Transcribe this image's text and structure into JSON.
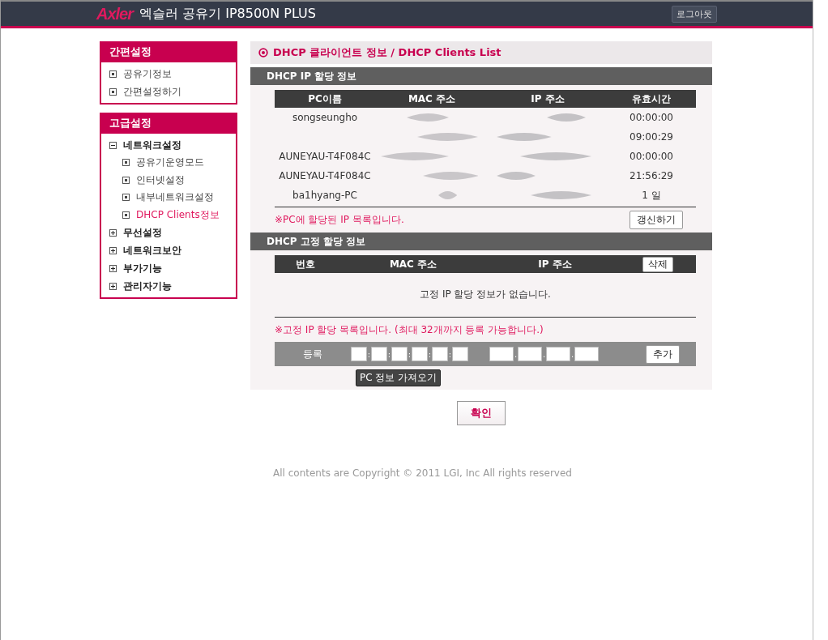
{
  "header": {
    "logo": "Axler",
    "title": "엑슬러 공유기 IP8500N PLUS",
    "logout_button": "로그아웃"
  },
  "sidebar": {
    "sections": [
      {
        "title": "간편설정",
        "items": [
          {
            "label": "공유기정보",
            "selected": false
          },
          {
            "label": "간편설정하기",
            "selected": false
          }
        ]
      },
      {
        "title": "고급설정",
        "items": [
          {
            "label": "네트워크설정",
            "expanded": true,
            "children": [
              {
                "label": "공유기운영모드",
                "selected": false
              },
              {
                "label": "인터넷설정",
                "selected": false
              },
              {
                "label": "내부네트워크설정",
                "selected": false
              },
              {
                "label": "DHCP Clients정보",
                "selected": true
              }
            ]
          },
          {
            "label": "무선설정",
            "expanded": false
          },
          {
            "label": "네트워크보안",
            "expanded": false
          },
          {
            "label": "부가기능",
            "expanded": false
          },
          {
            "label": "관리자기능",
            "expanded": false
          }
        ]
      }
    ]
  },
  "page_title": "DHCP 클라이언트 정보 / DHCP Clients List",
  "clients": {
    "heading": "DHCP IP 할당 정보",
    "columns": [
      "PC이름",
      "MAC 주소",
      "IP 주소",
      "유효시간"
    ],
    "rows": [
      {
        "pc_name": "songseungho",
        "lease": "00:00:00"
      },
      {
        "lease": "09:00:29"
      },
      {
        "pc_name": "AUNEYAU-T4F084C",
        "lease": "00:00:00"
      },
      {
        "pc_name": "AUNEYAU-T4F084C",
        "lease": "21:56:29"
      },
      {
        "pc_name": "ba1hyang-PC",
        "lease": "1 일"
      }
    ],
    "note": "※PC에 할당된 IP 목록입니다.",
    "refresh_button": "갱신하기"
  },
  "static": {
    "heading": "DHCP 고정 할당 정보",
    "columns": [
      "번호",
      "MAC 주소",
      "IP 주소"
    ],
    "delete_button": "삭제",
    "empty_message": "고정 IP 할당 정보가 없습니다.",
    "note": "※고정 IP 할당 목록입니다. (최대 32개까지 등록 가능합니다.)",
    "register_label": "등록",
    "mac_separator": ":",
    "ip_separator": ".",
    "add_button": "추가",
    "fetch_button": "PC 정보 가져오기"
  },
  "confirm_button": "확인",
  "footer": "All contents are Copyright © 2011 LGI, Inc All rights reserved"
}
